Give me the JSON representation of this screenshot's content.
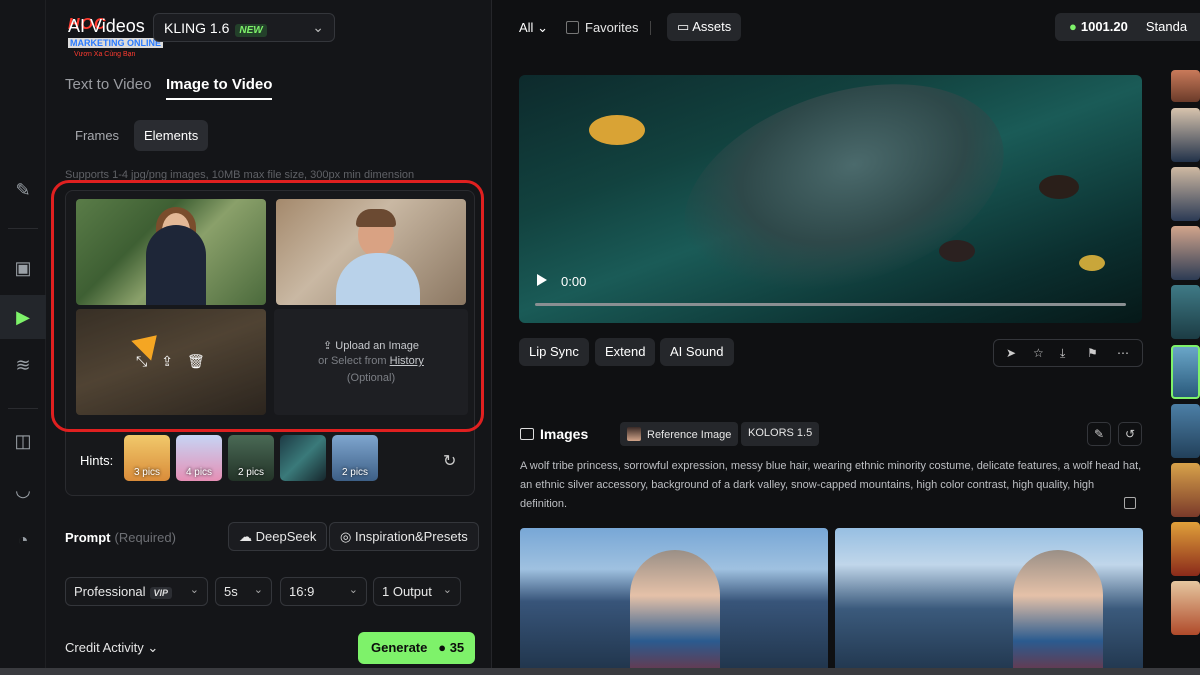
{
  "branding": {
    "logo_mark": "HOC",
    "logo_line1": "MARKETING ONLINE",
    "logo_line2": "Vươn Xa Cùng Bạn"
  },
  "header": {
    "app_title": "AI Videos",
    "model": "KLING 1.6",
    "model_badge": "NEW"
  },
  "tabs": [
    "Text to Video",
    "Image to Video"
  ],
  "active_tab": "Image to Video",
  "mode_segments": [
    "Frames",
    "Elements"
  ],
  "active_segment": "Elements",
  "upload": {
    "supports_text": "Supports 1-4 jpg/png images, 10MB max file size, 300px min dimension",
    "upload_label": "Upload an Image",
    "select_prefix": "or Select from",
    "history_link": "History",
    "optional": "(Optional)"
  },
  "hints": {
    "label": "Hints:",
    "items": [
      {
        "count": "3 pics"
      },
      {
        "count": "4 pics"
      },
      {
        "count": "2 pics"
      },
      {
        "count": ""
      },
      {
        "count": "2 pics"
      }
    ]
  },
  "prompt": {
    "label": "Prompt",
    "required": "(Required)",
    "deepseek": "DeepSeek",
    "inspiration": "Inspiration&Presets"
  },
  "settings": {
    "quality": "Professional",
    "quality_badge": "VIP",
    "duration": "5s",
    "ratio": "16:9",
    "outputs": "1 Output"
  },
  "footer": {
    "credit_activity": "Credit Activity",
    "generate": "Generate",
    "generate_cost": "35"
  },
  "topbar": {
    "filter": "All",
    "favorites": "Favorites",
    "assets": "Assets",
    "credits": "1001.20",
    "plan": "Standa"
  },
  "video": {
    "time": "0:00",
    "actions": [
      "Lip Sync",
      "Extend",
      "AI Sound"
    ]
  },
  "images_section": {
    "title": "Images",
    "reference_tag": "Reference Image",
    "model_tag": "KOLORS 1.5",
    "description": "A wolf tribe princess, sorrowful expression, messy blue hair, wearing ethnic minority costume, delicate features, a wolf head hat, an ethnic silver accessory, background of a dark valley, snow-capped mountains, high color contrast, high quality, high definition."
  },
  "colors": {
    "accent": "#7ef26a",
    "highlight": "#e02020",
    "background": "#0f1012",
    "panel": "#141518"
  },
  "icons": {
    "rail": [
      "brush-icon",
      "image-icon",
      "video-icon",
      "audio-icon",
      "model-icon",
      "lips-icon",
      "history-icon"
    ]
  }
}
